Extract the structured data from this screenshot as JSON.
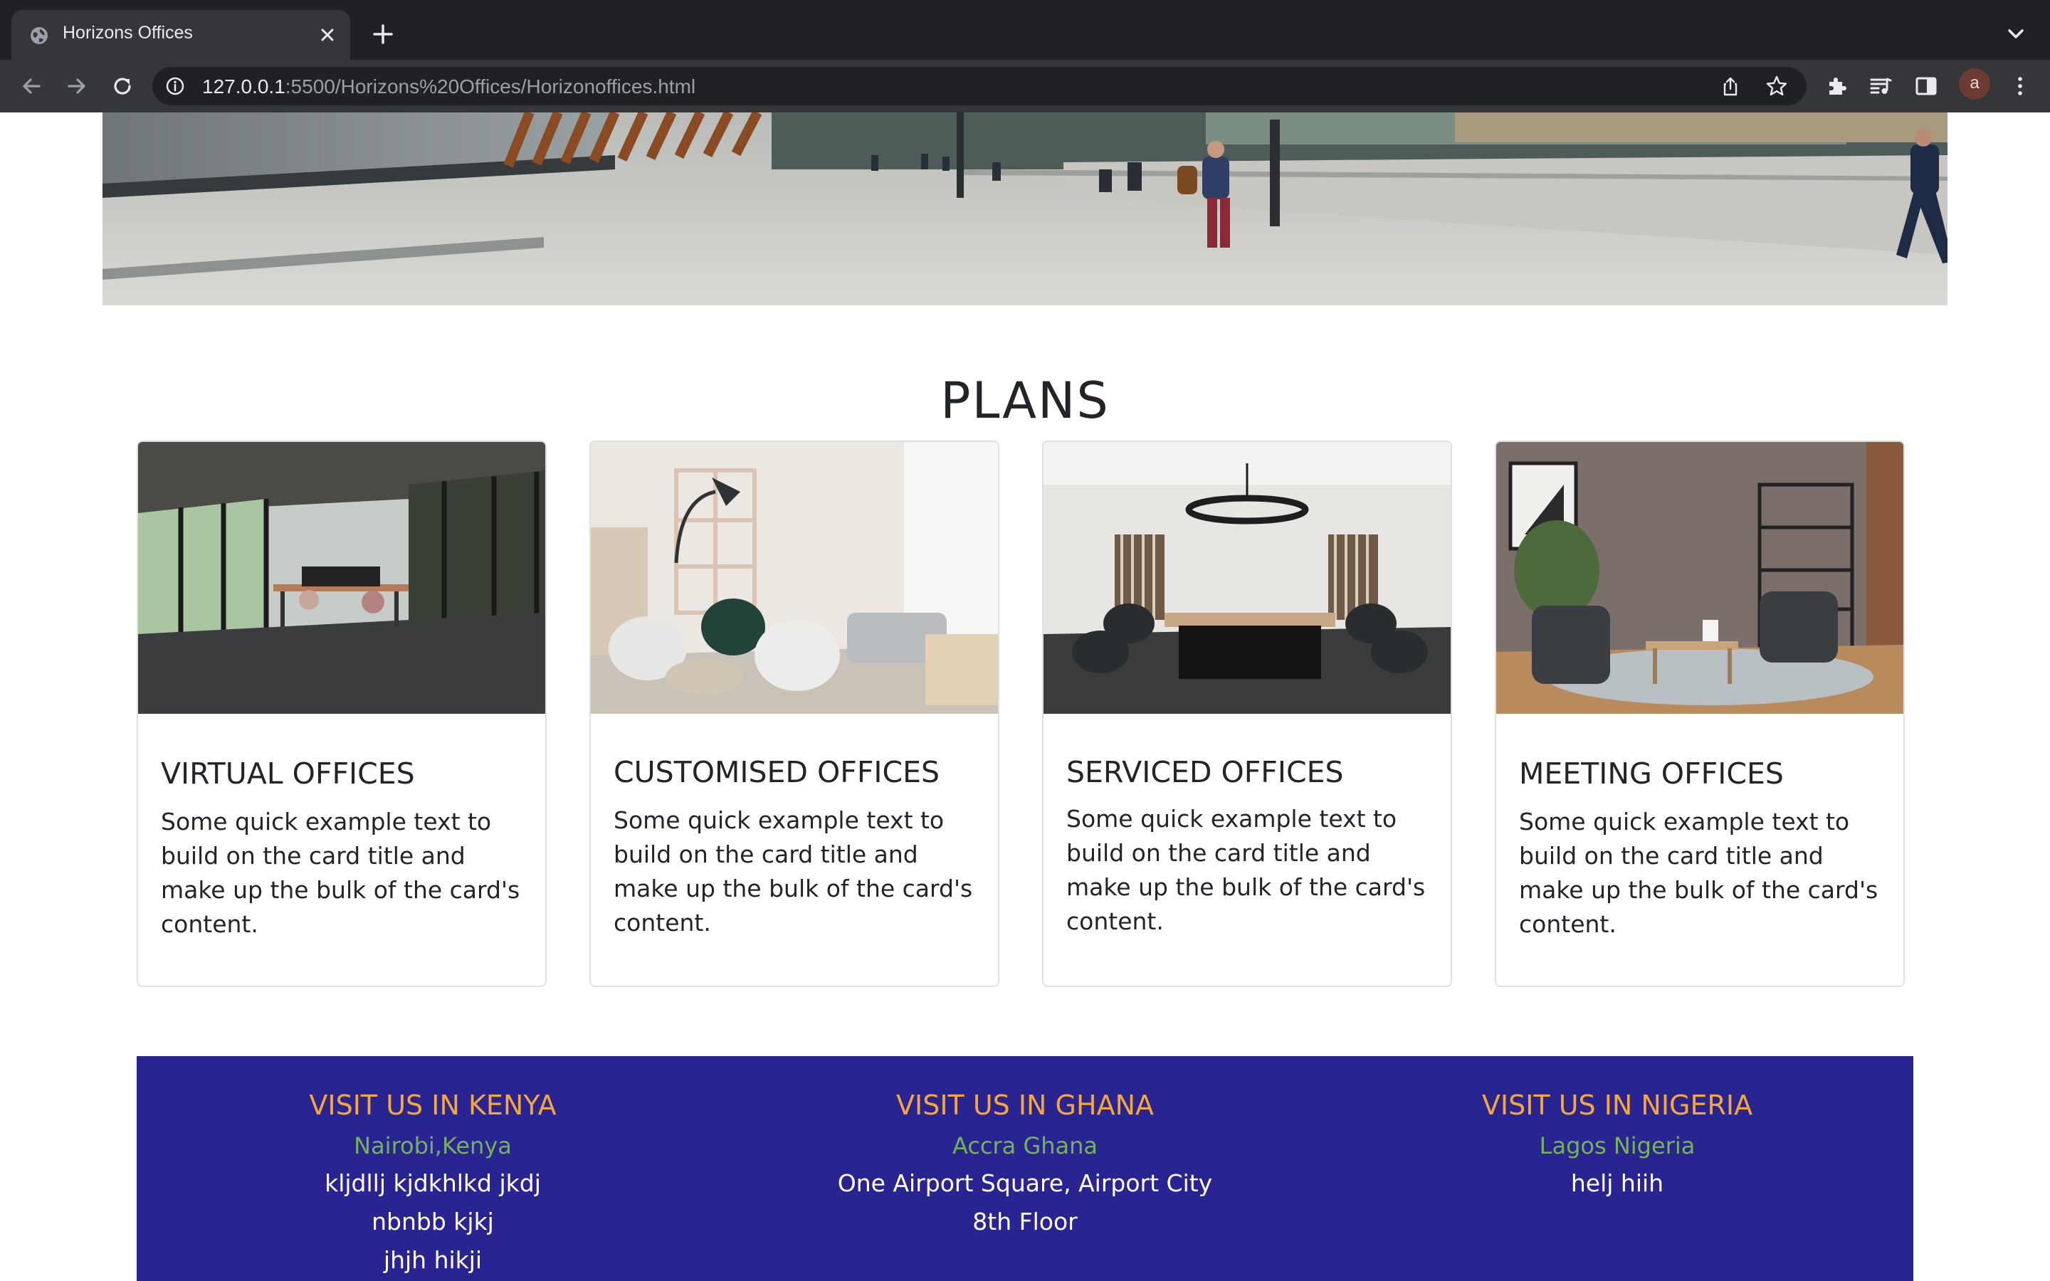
{
  "browser": {
    "tab_title": "Horizons Offices",
    "url_host": "127.0.0.1",
    "url_path": ":5500/Horizons%20Offices/Horizonoffices.html",
    "profile_initial": "a",
    "icons": [
      "globe-icon",
      "close-icon",
      "plus-icon",
      "chevron-down-icon",
      "back-arrow-icon",
      "forward-arrow-icon",
      "reload-icon",
      "info-icon",
      "share-icon",
      "star-icon",
      "extensions-icon",
      "media-control-icon",
      "side-panel-icon",
      "kebab-menu-icon"
    ]
  },
  "plans": {
    "heading": "PLANS",
    "cards": [
      {
        "title": "VIRTUAL OFFICES",
        "text": "Some quick example text to build on the card title and make up the bulk of the card's content."
      },
      {
        "title": "CUSTOMISED OFFICES",
        "text": "Some quick example text to build on the card title and make up the bulk of the card's content."
      },
      {
        "title": "SERVICED OFFICES",
        "text": "Some quick example text to build on the card title and make up the bulk of the card's content."
      },
      {
        "title": "MEETING OFFICES",
        "text": "Some quick example text to build on the card title and make up the bulk of the card's content."
      }
    ]
  },
  "footer": {
    "columns": [
      {
        "title": "VISIT US IN KENYA",
        "city": "Nairobi,Kenya",
        "lines": [
          "kljdllj kjdkhlkd jkdj",
          "nbnbb kjkj",
          "jhjh hikji"
        ]
      },
      {
        "title": "VISIT US IN GHANA",
        "city": "Accra Ghana",
        "lines": [
          "One Airport Square, Airport City",
          "8th Floor"
        ]
      },
      {
        "title": "VISIT US IN NIGERIA",
        "city": "Lagos Nigeria",
        "lines": [
          "helj hiih"
        ]
      }
    ]
  },
  "colors": {
    "chrome_dark": "#202124",
    "chrome_mid": "#35363a",
    "footer_bg": "#2a2492",
    "footer_title": "#f5a83a",
    "footer_city": "#73b455",
    "text": "#212529"
  }
}
